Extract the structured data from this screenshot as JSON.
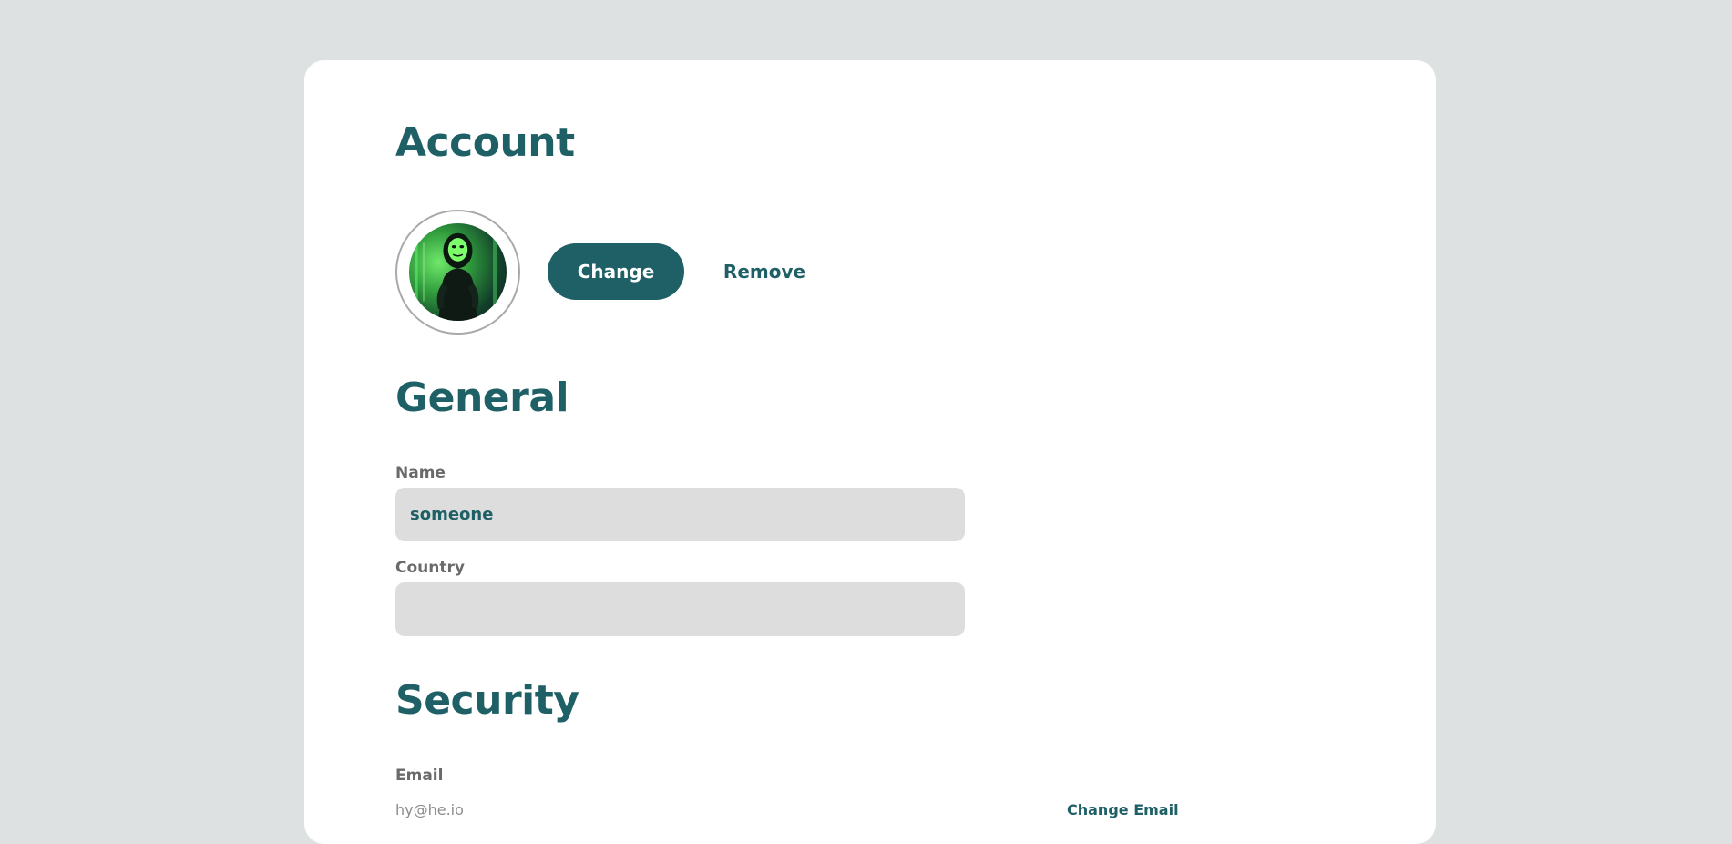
{
  "colors": {
    "page_background": "#dee1e1",
    "card_background": "#ffffff",
    "accent": "#1e6066",
    "input_background": "#dcdddc",
    "label_gray": "#6a6a6a"
  },
  "account": {
    "title": "Account",
    "avatar_icon": "profile-photo",
    "change_label": "Change",
    "remove_label": "Remove"
  },
  "general": {
    "title": "General",
    "name_label": "Name",
    "name_value": "someone",
    "country_label": "Country",
    "country_value": ""
  },
  "security": {
    "title": "Security",
    "email_label": "Email",
    "email_value": "hy@he.io",
    "change_email_label": "Change Email"
  }
}
